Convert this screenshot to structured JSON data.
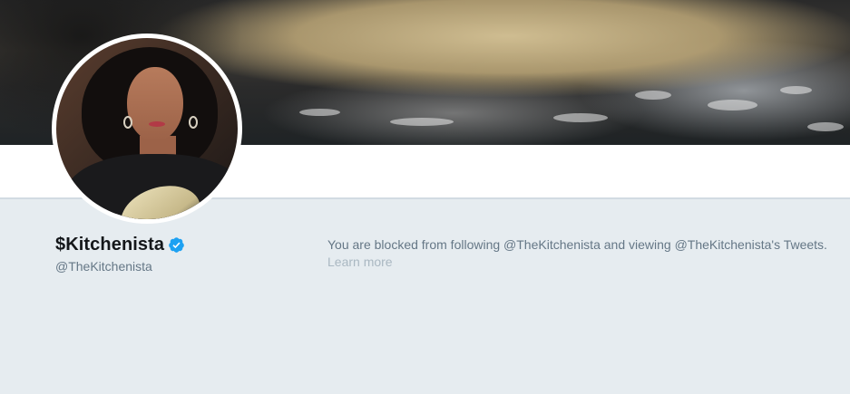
{
  "profile": {
    "display_name": "$Kitchenista",
    "handle": "@TheKitchenista",
    "verified": true
  },
  "blocked_notice": {
    "message": "You are blocked from following @TheKitchenista and viewing @TheKitchenista's Tweets.",
    "learn_more_label": "Learn more"
  },
  "colors": {
    "background": "#e6ecf0",
    "verified_badge": "#1da1f2",
    "name_text": "#14171a",
    "secondary_text": "#657786",
    "muted_link": "#aab8c2"
  },
  "icons": {
    "verified": "verified-badge-icon"
  }
}
